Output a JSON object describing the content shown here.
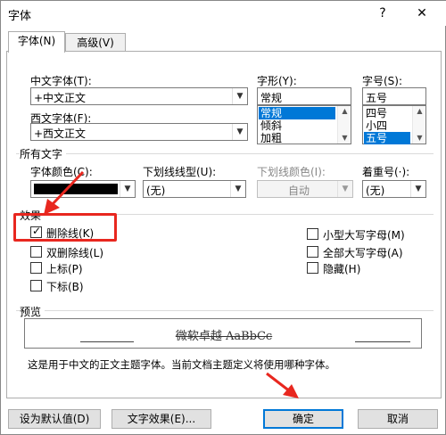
{
  "window": {
    "title": "字体",
    "help": "?",
    "close": "✕"
  },
  "tabs": [
    {
      "label": "字体(N)"
    },
    {
      "label": "高级(V)"
    }
  ],
  "font": {
    "chinese_label": "中文字体(T):",
    "chinese_value": "+中文正文",
    "western_label": "西文字体(F):",
    "western_value": "+西文正文",
    "style_label": "字形(Y):",
    "style_value": "常规",
    "style_options": [
      "常规",
      "倾斜",
      "加粗"
    ],
    "size_label": "字号(S):",
    "size_value": "五号",
    "size_options": [
      "四号",
      "小四",
      "五号"
    ]
  },
  "all_text": {
    "section_title": "所有文字",
    "color_label": "字体颜色(C):",
    "color_value": "#000000",
    "underline_label": "下划线线型(U):",
    "underline_value": "(无)",
    "underline_color_label": "下划线颜色(I):",
    "underline_color_value": "自动",
    "emphasis_label": "着重号(·):",
    "emphasis_value": "(无)"
  },
  "effects": {
    "section_title": "效果",
    "strike": {
      "label": "删除线(K)",
      "checked": true
    },
    "double_strike": {
      "label": "双删除线(L)",
      "checked": false
    },
    "superscript": {
      "label": "上标(P)",
      "checked": false
    },
    "subscript": {
      "label": "下标(B)",
      "checked": false
    },
    "small_caps": {
      "label": "小型大写字母(M)",
      "checked": false
    },
    "all_caps": {
      "label": "全部大写字母(A)",
      "checked": false
    },
    "hidden": {
      "label": "隐藏(H)",
      "checked": false
    }
  },
  "preview": {
    "section_title": "预览",
    "sample_text": "微软卓越 AaBbCc",
    "description": "这是用于中文的正文主题字体。当前文档主题定义将使用哪种字体。"
  },
  "buttons": {
    "set_default": "设为默认值(D)",
    "text_effects": "文字效果(E)...",
    "ok": "确定",
    "cancel": "取消"
  },
  "highlight_color": "#e8271f",
  "icons": {
    "dropdown": "chevron-down-icon",
    "check": "check-icon",
    "close": "close-icon",
    "arrow": "red-arrow-icon"
  }
}
